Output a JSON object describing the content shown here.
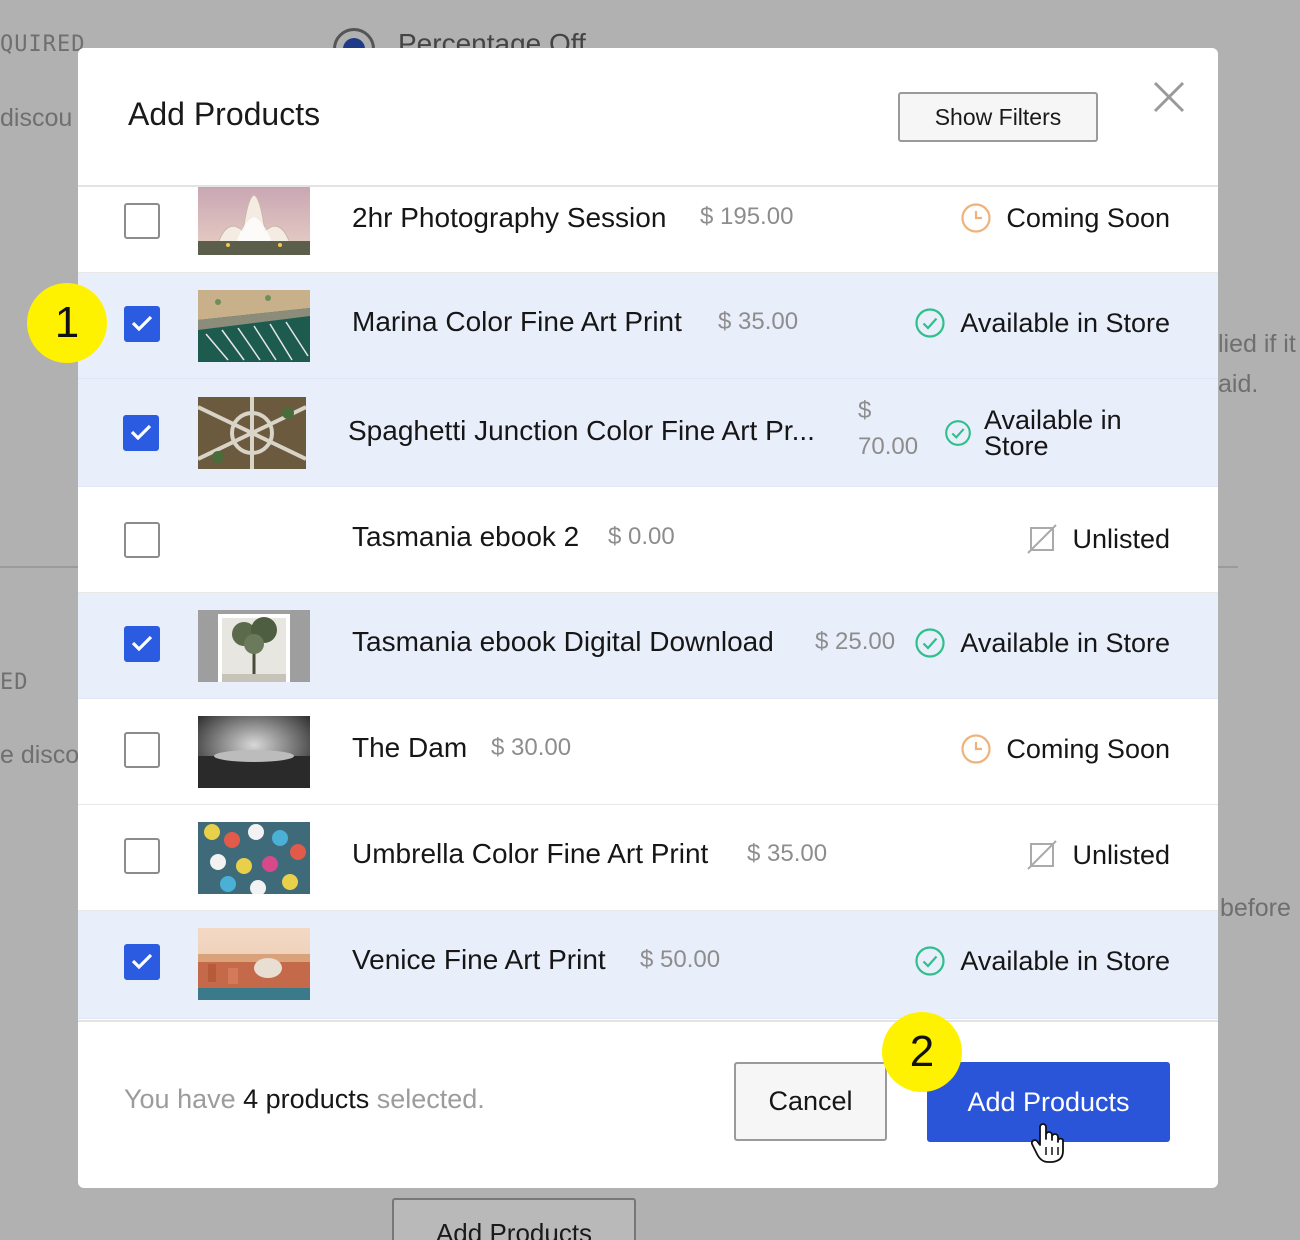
{
  "background": {
    "required_label": "QUIRED",
    "radio_label": "Percentage Off",
    "discount_text": "discou",
    "applied_text_1": "lied if it",
    "applied_text_2": "aid.",
    "ed_label": "ED",
    "discount_text_2": "e disco",
    "before_text": "before",
    "add_products_button": "Add Products"
  },
  "modal": {
    "title": "Add Products",
    "show_filters_label": "Show Filters"
  },
  "products": [
    {
      "name": "2hr Photography Session",
      "price": "$ 195.00",
      "status": "Coming Soon",
      "status_icon": "clock-icon",
      "selected": false,
      "thumb": "lotus-temple"
    },
    {
      "name": "Marina Color Fine Art Print",
      "price": "$ 35.00",
      "status": "Available in Store",
      "status_icon": "check-circle-icon",
      "selected": true,
      "thumb": "marina"
    },
    {
      "name": "Spaghetti Junction Color Fine Art Pr...",
      "price": "$ 70.00",
      "price_line1": "$",
      "price_line2": "70.00",
      "status": "Available in Store",
      "status_line1": "Available in",
      "status_line2": "Store",
      "status_icon": "check-circle-icon",
      "selected": true,
      "thumb": "junction"
    },
    {
      "name": "Tasmania ebook 2",
      "price": "$ 0.00",
      "status": "Unlisted",
      "status_icon": "unlisted-icon",
      "selected": false,
      "thumb": ""
    },
    {
      "name": "Tasmania ebook Digital Download",
      "price": "$ 25.00",
      "status": "Available in Store",
      "status_icon": "check-circle-icon",
      "selected": true,
      "thumb": "tree"
    },
    {
      "name": "The Dam",
      "price": "$ 30.00",
      "status": "Coming Soon",
      "status_icon": "clock-icon",
      "selected": false,
      "thumb": "dam"
    },
    {
      "name": "Umbrella Color Fine Art Print",
      "price": "$ 35.00",
      "status": "Unlisted",
      "status_icon": "unlisted-icon",
      "selected": false,
      "thumb": "umbrella"
    },
    {
      "name": "Venice Fine Art Print",
      "price": "$ 50.00",
      "status": "Available in Store",
      "status_icon": "check-circle-icon",
      "selected": true,
      "thumb": "venice"
    }
  ],
  "footer": {
    "selected_prefix": "You have",
    "selected_count": "4 products",
    "selected_suffix": "selected.",
    "cancel_label": "Cancel",
    "add_label": "Add Products"
  },
  "callouts": {
    "step1": "1",
    "step2": "2"
  },
  "colors": {
    "accent": "#2b55d8",
    "selected_row": "#e9eefb",
    "available": "#2fbf8a",
    "coming_soon": "#f0b27a",
    "callout": "#fff200"
  }
}
